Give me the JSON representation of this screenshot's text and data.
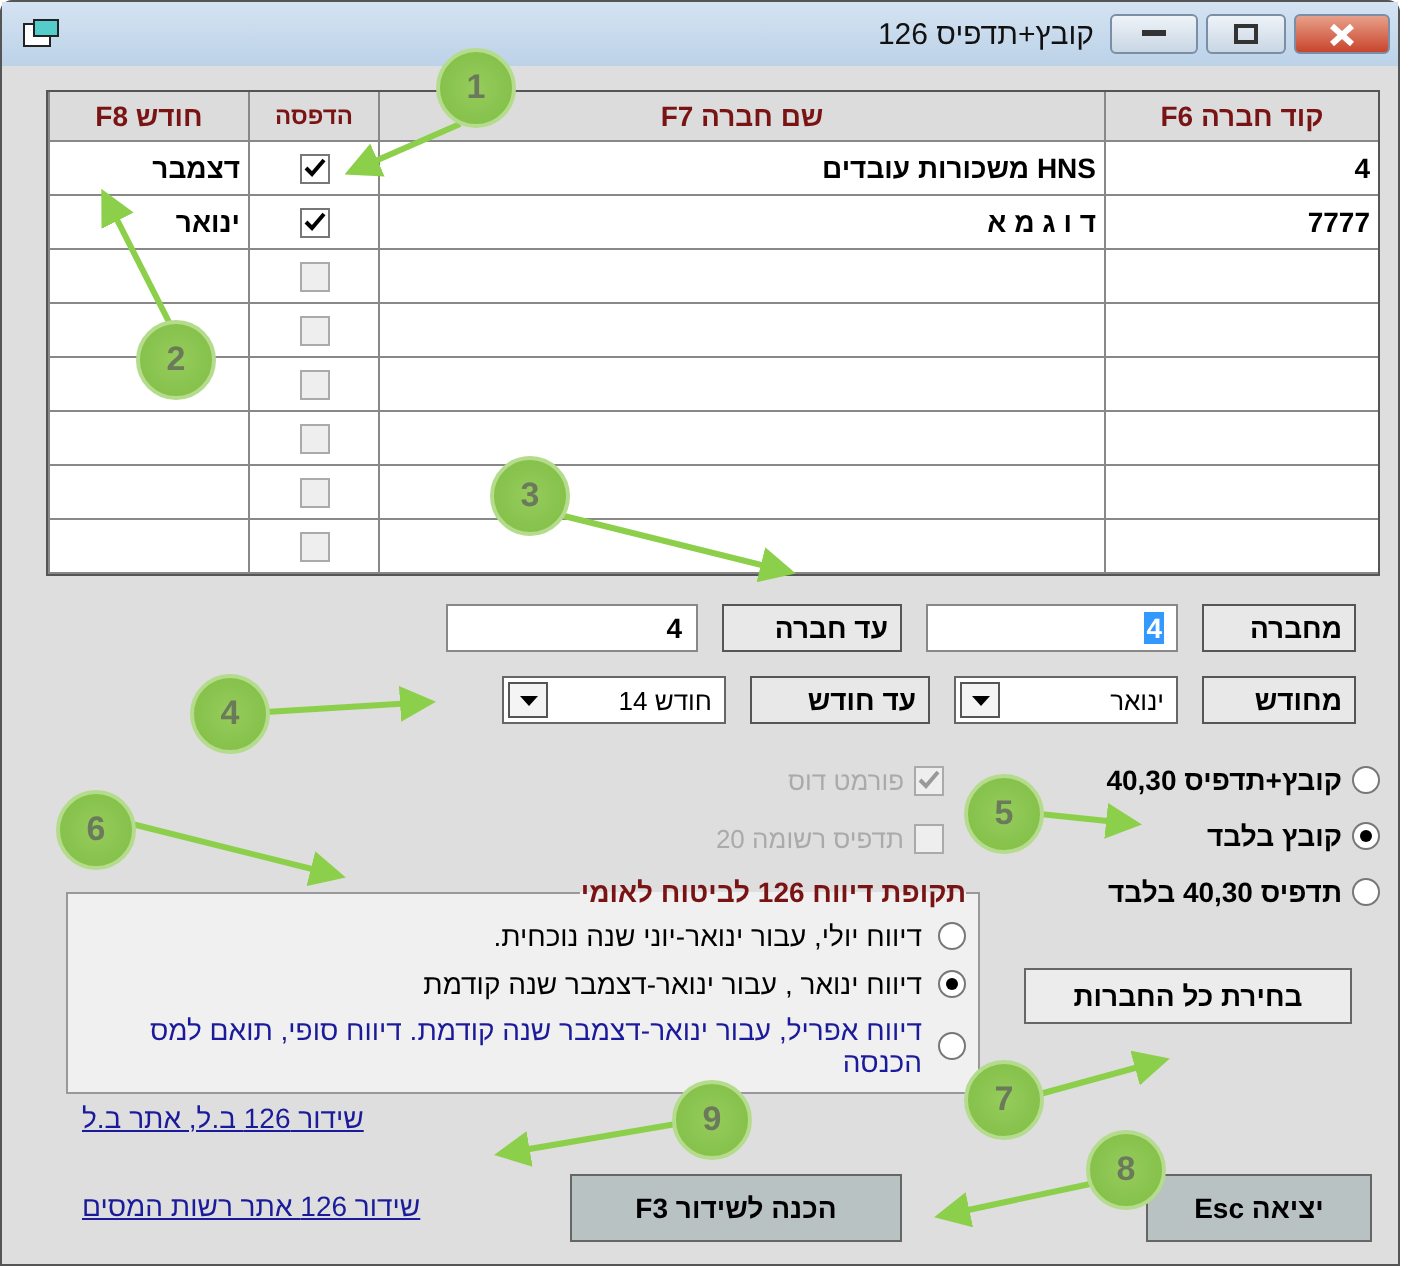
{
  "window": {
    "title": "קובץ+תדפיס 126"
  },
  "table": {
    "columns": [
      "קוד חברה F6",
      "שם חברה F7",
      "הדפסה",
      "חודש F8"
    ],
    "rows": [
      {
        "code": "4",
        "name": "HNS משכורות עובדים",
        "checked": true,
        "month": "דצמבר"
      },
      {
        "code": "7777",
        "name": "ד ו ג מ א",
        "checked": true,
        "month": "ינואר"
      },
      {
        "checked": false
      },
      {
        "checked": false
      },
      {
        "checked": false
      },
      {
        "checked": false
      },
      {
        "checked": false
      },
      {
        "checked": false
      }
    ]
  },
  "filters": [
    {
      "label": "מחברה",
      "kind": "input",
      "value": "4",
      "highlighted": true
    },
    {
      "label": "עד חברה",
      "kind": "input",
      "value": "4",
      "highlighted": false
    },
    {
      "label": "מחודש",
      "kind": "select",
      "value": "ינואר"
    },
    {
      "label": "עד חודש",
      "kind": "select",
      "value": "חודש 14"
    }
  ],
  "output_options": [
    {
      "label": "קובץ+תדפיס 40,30",
      "selected": false
    },
    {
      "label": "קובץ בלבד",
      "selected": true
    },
    {
      "label": "תדפיס 40,30 בלבד",
      "selected": false
    }
  ],
  "extra_options": [
    {
      "label": "פורמט דוס",
      "checked": true,
      "disabled": true
    },
    {
      "label": "תדפיס רשומה 20",
      "checked": false,
      "disabled": true
    }
  ],
  "period_group": {
    "title": "תקופת דיווח 126 לביטוח לאומי",
    "options": [
      {
        "label": "דיווח יולי, עבור ינואר-יוני שנה נוכחית.",
        "selected": false,
        "color": "#000000"
      },
      {
        "label": "דיווח ינואר , עבור ינואר-דצמבר שנה קודמת",
        "selected": true,
        "color": "#000000"
      },
      {
        "label": "דיווח אפריל, עבור ינואר-דצמבר שנה קודמת. דיווח סופי, תואם למס הכנסה",
        "selected": false,
        "color": "#1a1a9a"
      }
    ]
  },
  "select_all_button": "בחירת כל החברות",
  "links": [
    "שידור 126 ב.ל, אתר ב.ל",
    "שידור 126 אתר רשות המסים"
  ],
  "buttons": [
    "יציאה Esc",
    "הכנה לשידור F3"
  ],
  "callouts": [
    "1",
    "2",
    "3",
    "4",
    "5",
    "6",
    "7",
    "8",
    "9"
  ]
}
